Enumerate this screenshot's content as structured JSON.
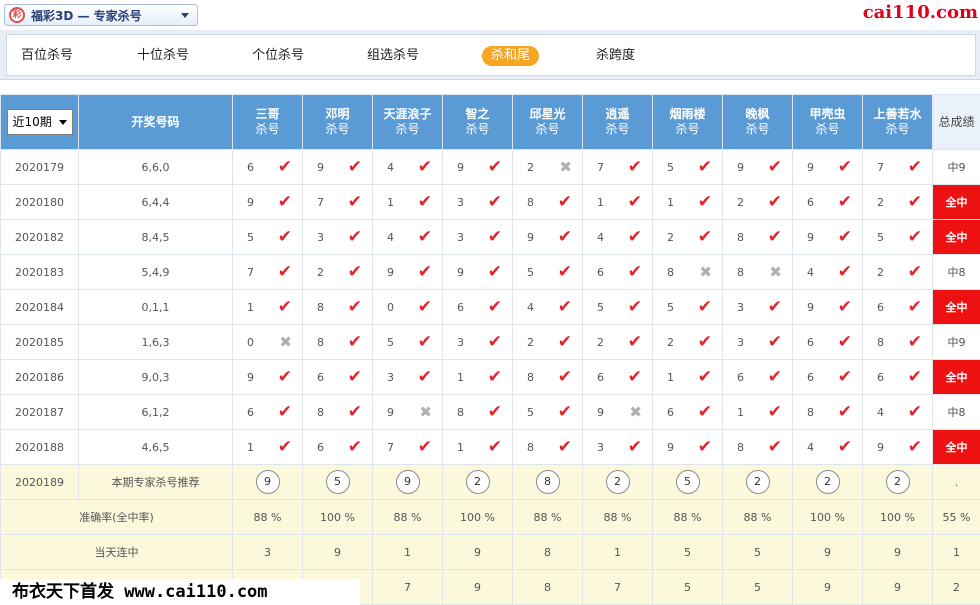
{
  "header": {
    "logo_glyph": "彩",
    "title": "福彩3D — 专家杀号",
    "watermark_top": "cai110.com"
  },
  "tabs": [
    {
      "label": "百位杀号",
      "active": false
    },
    {
      "label": "十位杀号",
      "active": false
    },
    {
      "label": "个位杀号",
      "active": false
    },
    {
      "label": "组选杀号",
      "active": false
    },
    {
      "label": "杀和尾",
      "active": true
    },
    {
      "label": "杀跨度",
      "active": false
    }
  ],
  "table": {
    "period_select": "近10期",
    "draw_header": "开奖号码",
    "total_header": "总成绩",
    "kill_label": "杀号",
    "experts": [
      "三哥",
      "邓明",
      "天涯浪子",
      "智之",
      "邱星光",
      "逍遥",
      "烟雨楼",
      "晚枫",
      "甲壳虫",
      "上善若水"
    ],
    "rows": [
      {
        "issue": "2020179",
        "draw": "6,6,0",
        "cells": [
          [
            "6",
            "ok"
          ],
          [
            "9",
            "ok"
          ],
          [
            "4",
            "ok"
          ],
          [
            "9",
            "ok"
          ],
          [
            "2",
            "bad"
          ],
          [
            "7",
            "ok"
          ],
          [
            "5",
            "ok"
          ],
          [
            "9",
            "ok"
          ],
          [
            "9",
            "ok"
          ],
          [
            "7",
            "ok"
          ]
        ],
        "total": "中9",
        "win": false
      },
      {
        "issue": "2020180",
        "draw": "6,4,4",
        "cells": [
          [
            "9",
            "ok"
          ],
          [
            "7",
            "ok"
          ],
          [
            "1",
            "ok"
          ],
          [
            "3",
            "ok"
          ],
          [
            "8",
            "ok"
          ],
          [
            "1",
            "ok"
          ],
          [
            "1",
            "ok"
          ],
          [
            "2",
            "ok"
          ],
          [
            "6",
            "ok"
          ],
          [
            "2",
            "ok"
          ]
        ],
        "total": "全中",
        "win": true
      },
      {
        "issue": "2020182",
        "draw": "8,4,5",
        "cells": [
          [
            "5",
            "ok"
          ],
          [
            "3",
            "ok"
          ],
          [
            "4",
            "ok"
          ],
          [
            "3",
            "ok"
          ],
          [
            "9",
            "ok"
          ],
          [
            "4",
            "ok"
          ],
          [
            "2",
            "ok"
          ],
          [
            "8",
            "ok"
          ],
          [
            "9",
            "ok"
          ],
          [
            "5",
            "ok"
          ]
        ],
        "total": "全中",
        "win": true
      },
      {
        "issue": "2020183",
        "draw": "5,4,9",
        "cells": [
          [
            "7",
            "ok"
          ],
          [
            "2",
            "ok"
          ],
          [
            "9",
            "ok"
          ],
          [
            "9",
            "ok"
          ],
          [
            "5",
            "ok"
          ],
          [
            "6",
            "ok"
          ],
          [
            "8",
            "bad"
          ],
          [
            "8",
            "bad"
          ],
          [
            "4",
            "ok"
          ],
          [
            "2",
            "ok"
          ]
        ],
        "total": "中8",
        "win": false
      },
      {
        "issue": "2020184",
        "draw": "0,1,1",
        "cells": [
          [
            "1",
            "ok"
          ],
          [
            "8",
            "ok"
          ],
          [
            "0",
            "ok"
          ],
          [
            "6",
            "ok"
          ],
          [
            "4",
            "ok"
          ],
          [
            "5",
            "ok"
          ],
          [
            "5",
            "ok"
          ],
          [
            "3",
            "ok"
          ],
          [
            "9",
            "ok"
          ],
          [
            "6",
            "ok"
          ]
        ],
        "total": "全中",
        "win": true
      },
      {
        "issue": "2020185",
        "draw": "1,6,3",
        "cells": [
          [
            "0",
            "bad"
          ],
          [
            "8",
            "ok"
          ],
          [
            "5",
            "ok"
          ],
          [
            "3",
            "ok"
          ],
          [
            "2",
            "ok"
          ],
          [
            "2",
            "ok"
          ],
          [
            "2",
            "ok"
          ],
          [
            "3",
            "ok"
          ],
          [
            "6",
            "ok"
          ],
          [
            "8",
            "ok"
          ]
        ],
        "total": "中9",
        "win": false
      },
      {
        "issue": "2020186",
        "draw": "9,0,3",
        "cells": [
          [
            "9",
            "ok"
          ],
          [
            "6",
            "ok"
          ],
          [
            "3",
            "ok"
          ],
          [
            "1",
            "ok"
          ],
          [
            "8",
            "ok"
          ],
          [
            "6",
            "ok"
          ],
          [
            "1",
            "ok"
          ],
          [
            "6",
            "ok"
          ],
          [
            "6",
            "ok"
          ],
          [
            "6",
            "ok"
          ]
        ],
        "total": "全中",
        "win": true
      },
      {
        "issue": "2020187",
        "draw": "6,1,2",
        "cells": [
          [
            "6",
            "ok"
          ],
          [
            "8",
            "ok"
          ],
          [
            "9",
            "bad"
          ],
          [
            "8",
            "ok"
          ],
          [
            "5",
            "ok"
          ],
          [
            "9",
            "bad"
          ],
          [
            "6",
            "ok"
          ],
          [
            "1",
            "ok"
          ],
          [
            "8",
            "ok"
          ],
          [
            "4",
            "ok"
          ]
        ],
        "total": "中8",
        "win": false
      },
      {
        "issue": "2020188",
        "draw": "4,6,5",
        "cells": [
          [
            "1",
            "ok"
          ],
          [
            "6",
            "ok"
          ],
          [
            "7",
            "ok"
          ],
          [
            "1",
            "ok"
          ],
          [
            "8",
            "ok"
          ],
          [
            "3",
            "ok"
          ],
          [
            "9",
            "ok"
          ],
          [
            "8",
            "ok"
          ],
          [
            "4",
            "ok"
          ],
          [
            "9",
            "ok"
          ]
        ],
        "total": "全中",
        "win": true
      }
    ],
    "recommend": {
      "issue": "2020189",
      "label": "本期专家杀号推荐",
      "values": [
        "9",
        "5",
        "9",
        "2",
        "8",
        "2",
        "5",
        "2",
        "2",
        "2"
      ],
      "total": "."
    },
    "accuracy": {
      "label": "准确率(全中率)",
      "values": [
        "88 %",
        "100 %",
        "88 %",
        "100 %",
        "88 %",
        "88 %",
        "88 %",
        "88 %",
        "100 %",
        "100 %"
      ],
      "total": "55 %"
    },
    "streak": {
      "label": "当天连中",
      "values": [
        "3",
        "9",
        "1",
        "9",
        "8",
        "1",
        "5",
        "5",
        "9",
        "9"
      ],
      "total": "1"
    },
    "last_row": {
      "label": "",
      "values": [
        "",
        "",
        "7",
        "9",
        "8",
        "7",
        "5",
        "5",
        "9",
        "9"
      ],
      "total": "2"
    }
  },
  "watermark_bottom": "布衣天下首发 www.cai110.com",
  "colors": {
    "header_blue": "#5b9bd5",
    "hit_red": "#e8202a",
    "win_bg": "#ee1111",
    "active_tab": "#f6a623",
    "rec_bg": "#fcf8dc"
  }
}
